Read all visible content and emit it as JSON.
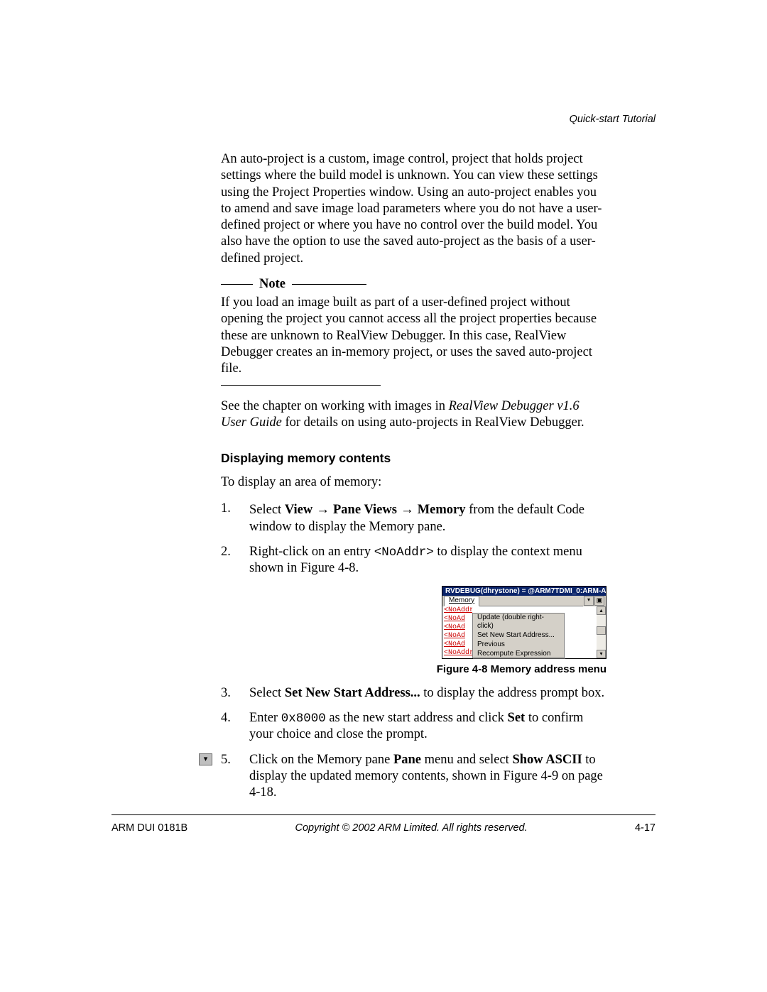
{
  "header": {
    "right": "Quick-start Tutorial"
  },
  "para1": "An auto-project is a custom, image control, project that holds project settings where the build model is unknown. You can view these settings using the Project Properties window. Using an auto-project enables you to amend and save image load parameters where you do not have a user-defined project or where you have no control over the build model. You also have the option to use the saved auto-project as the basis of a user-defined project.",
  "note": {
    "label": "Note",
    "body": "If you load an image built as part of a user-defined project without opening the project you cannot access all the project properties because these are unknown to RealView Debugger. In this case, RealView Debugger creates an in-memory project, or uses the saved auto-project file."
  },
  "para2": {
    "pre": "See the chapter on working with images in ",
    "em": "RealView Debugger v1.6 User Guide",
    "post": " for details on using auto-projects in RealView Debugger."
  },
  "section_heading": "Displaying memory contents",
  "lead": "To display an area of memory:",
  "step1": {
    "num": "1.",
    "a": "Select ",
    "view": "View",
    "arrow": " → ",
    "pane_views": "Pane Views",
    "memory": "Memory",
    "b": " from the default Code window to display the Memory pane."
  },
  "step2": {
    "num": "2.",
    "a": "Right-click on an entry ",
    "code": "<NoAddr>",
    "b": " to display the context menu shown in Figure 4-8."
  },
  "figure": {
    "caption": "Figure 4-8 Memory address menu",
    "titlebar": "RVDEBUG(dhrystone) = @ARM7TDMI_0:ARM-A-…",
    "tab": "Memory",
    "rows": [
      "<NoAddr>",
      "<NoAd",
      "<NoAd",
      "<NoAd",
      "<NoAd",
      "<NoAddr>"
    ],
    "menu": [
      "Update (double right-click)",
      "Set New Start Address...",
      "Previous",
      "Recompute Expression"
    ]
  },
  "step3": {
    "num": "3.",
    "a": "Select ",
    "cmd": "Set New Start Address...",
    "b": " to display the address prompt box."
  },
  "step4": {
    "num": "4.",
    "a": "Enter ",
    "code": "0x8000",
    "b": " as the new start address and click ",
    "set": "Set",
    "c": " to confirm your choice and close the prompt."
  },
  "step5": {
    "num": "5.",
    "a": "Click on the Memory pane ",
    "pane": "Pane",
    "b": " menu and select ",
    "ascii": "Show ASCII",
    "c": " to display the updated memory contents, shown in Figure 4-9 on page 4-18."
  },
  "footer": {
    "left": "ARM DUI 0181B",
    "center": "Copyright © 2002 ARM Limited. All rights reserved.",
    "right": "4-17"
  }
}
